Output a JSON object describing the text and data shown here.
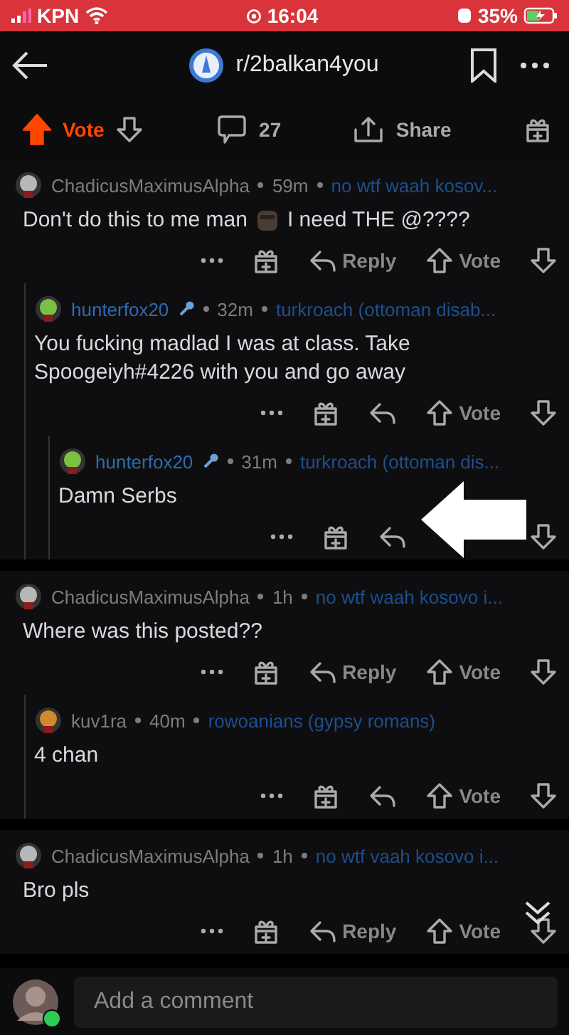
{
  "status_bar": {
    "carrier": "KPN",
    "time": "16:04",
    "battery": "35%"
  },
  "header": {
    "title": "r/2balkan4you"
  },
  "post_actions": {
    "vote": "Vote",
    "upvoted": true,
    "comments": "27",
    "share": "Share"
  },
  "comments": [
    {
      "author": "ChadicusMaximusAlpha",
      "highlighted": false,
      "age": "59m",
      "flair": "no wtf waah kosov...",
      "body": [
        {
          "kind": "text",
          "text": "Don't do this to me man"
        },
        {
          "kind": "emoji"
        },
        {
          "kind": "text",
          "text": "I need THE @????"
        }
      ],
      "reply": "Reply",
      "vote": "Vote",
      "children": [
        {
          "author": "hunterfox20",
          "highlighted": true,
          "age": "32m",
          "flair": "turkroach (ottoman disab...",
          "body": [
            {
              "kind": "text",
              "text": "You fucking madlad I was at class. Take Spoogeiyh#4226 with you and go away"
            }
          ],
          "vote": "Vote",
          "children": [
            {
              "author": "hunterfox20",
              "highlighted": true,
              "age": "31m",
              "flair": "turkroach (ottoman dis...",
              "body": [
                {
                  "kind": "text",
                  "text": "Damn Serbs"
                }
              ]
            }
          ]
        }
      ]
    },
    {
      "author": "ChadicusMaximusAlpha",
      "highlighted": false,
      "age": "1h",
      "flair": "no wtf waah kosovo i...",
      "body": [
        {
          "kind": "text",
          "text": "Where was this posted??"
        }
      ],
      "reply": "Reply",
      "vote": "Vote",
      "children": [
        {
          "author": "kuv1ra",
          "highlighted": false,
          "age": "40m",
          "flair": "rowoanians (gypsy romans)",
          "body": [
            {
              "kind": "text",
              "text": "4 chan"
            }
          ],
          "vote": "Vote"
        }
      ]
    },
    {
      "author": "ChadicusMaximusAlpha",
      "highlighted": false,
      "age": "1h",
      "flair": "no wtf vaah kosovo i...",
      "body": [
        {
          "kind": "text",
          "text": "Bro pls"
        }
      ],
      "reply": "Reply",
      "vote": "Vote"
    }
  ],
  "composer": {
    "placeholder": "Add a comment",
    "online": true
  }
}
